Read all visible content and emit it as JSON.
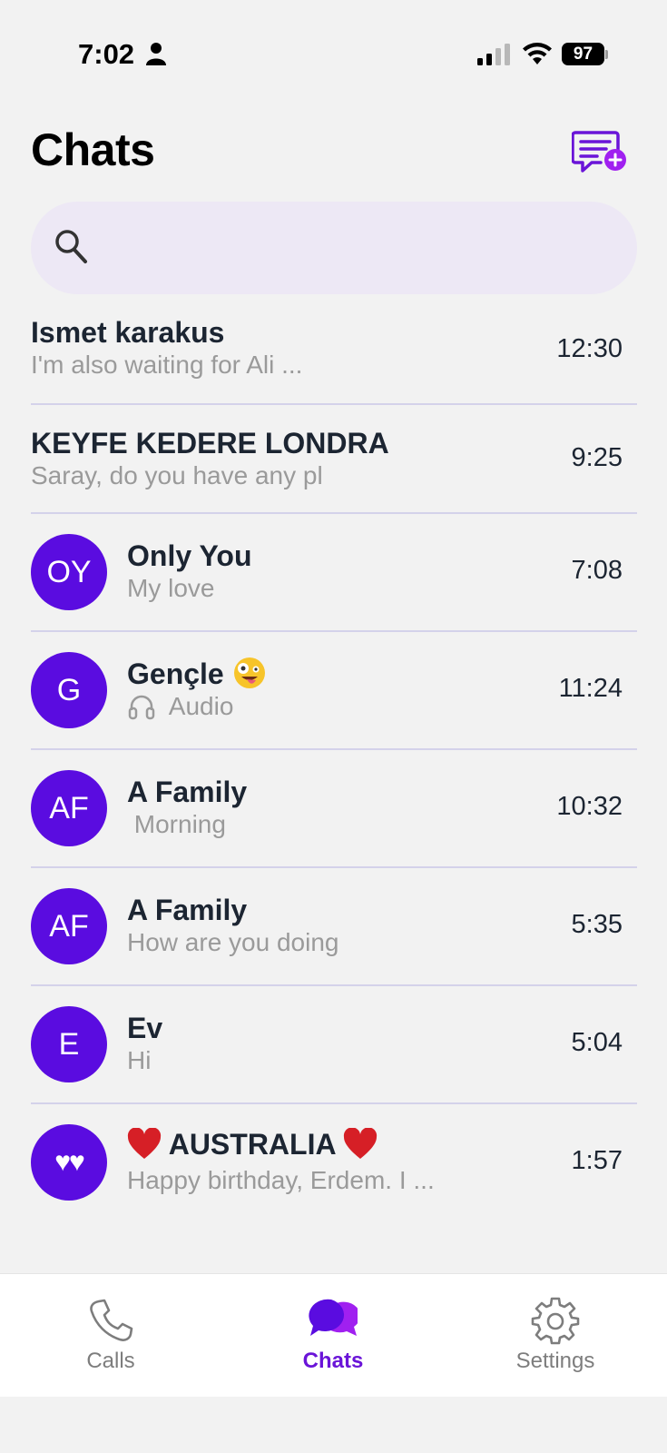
{
  "status_bar": {
    "time": "7:02",
    "battery": "97"
  },
  "header": {
    "title": "Chats"
  },
  "search": {
    "placeholder": ""
  },
  "chats": [
    {
      "name": "Ismet karakus",
      "preview": "I'm also waiting for Ali ...",
      "time": "12:30",
      "avatar": ""
    },
    {
      "name": "KEYFE KEDERE LONDRA",
      "preview": "Saray, do you have any pl",
      "time": "9:25",
      "avatar": ""
    },
    {
      "name": "Only You",
      "preview": "My love",
      "time": "7:08",
      "avatar": "OY"
    },
    {
      "name": "Gençle",
      "preview": "Audio",
      "time": "11:24",
      "avatar": "G"
    },
    {
      "name": "A Family",
      "preview": " Morning",
      "time": "10:32",
      "avatar": "AF"
    },
    {
      "name": "A Family",
      "preview": "How are you doing",
      "time": "5:35",
      "avatar": "AF"
    },
    {
      "name": "Ev",
      "preview": "Hi",
      "time": "5:04",
      "avatar": "E"
    },
    {
      "name": "AUSTRALIA",
      "preview": "Happy birthday, Erdem. I ...",
      "time": "1:57",
      "avatar": "♥♥"
    }
  ],
  "tabs": [
    {
      "label": "Calls",
      "icon": "phone-icon"
    },
    {
      "label": "Chats",
      "icon": "chat-bubbles-icon"
    },
    {
      "label": "Settings",
      "icon": "gear-icon"
    }
  ],
  "colors": {
    "accent": "#5a0ce0",
    "active_tab": "#6a14d8",
    "search_bg": "#ede8f5",
    "divider": "#d4d2ea"
  }
}
